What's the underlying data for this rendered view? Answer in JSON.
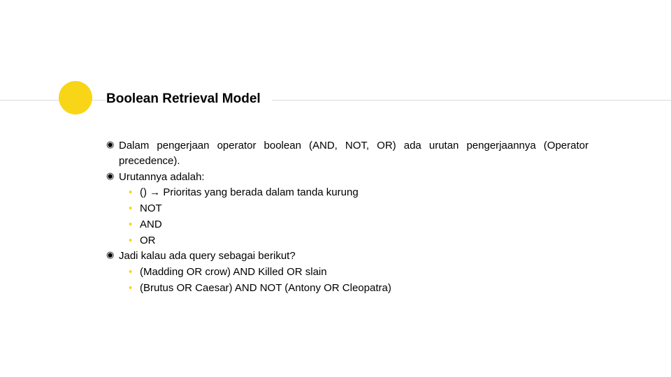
{
  "title": "Boolean Retrieval Model",
  "bullets": {
    "b1": "Dalam pengerjaan operator boolean (AND, NOT, OR) ada urutan pengerjaannya (Operator precedence).",
    "b2": "Urutannya adalah:",
    "b2_1": "() → Prioritas yang berada dalam tanda kurung",
    "b2_2": "NOT",
    "b2_3": "AND",
    "b2_4": "OR",
    "b3": "Jadi kalau ada query sebagai berikut?",
    "b3_1": "(Madding OR crow) AND Killed OR slain",
    "b3_2": "(Brutus OR Caesar) AND NOT (Antony OR Cleopatra)"
  }
}
